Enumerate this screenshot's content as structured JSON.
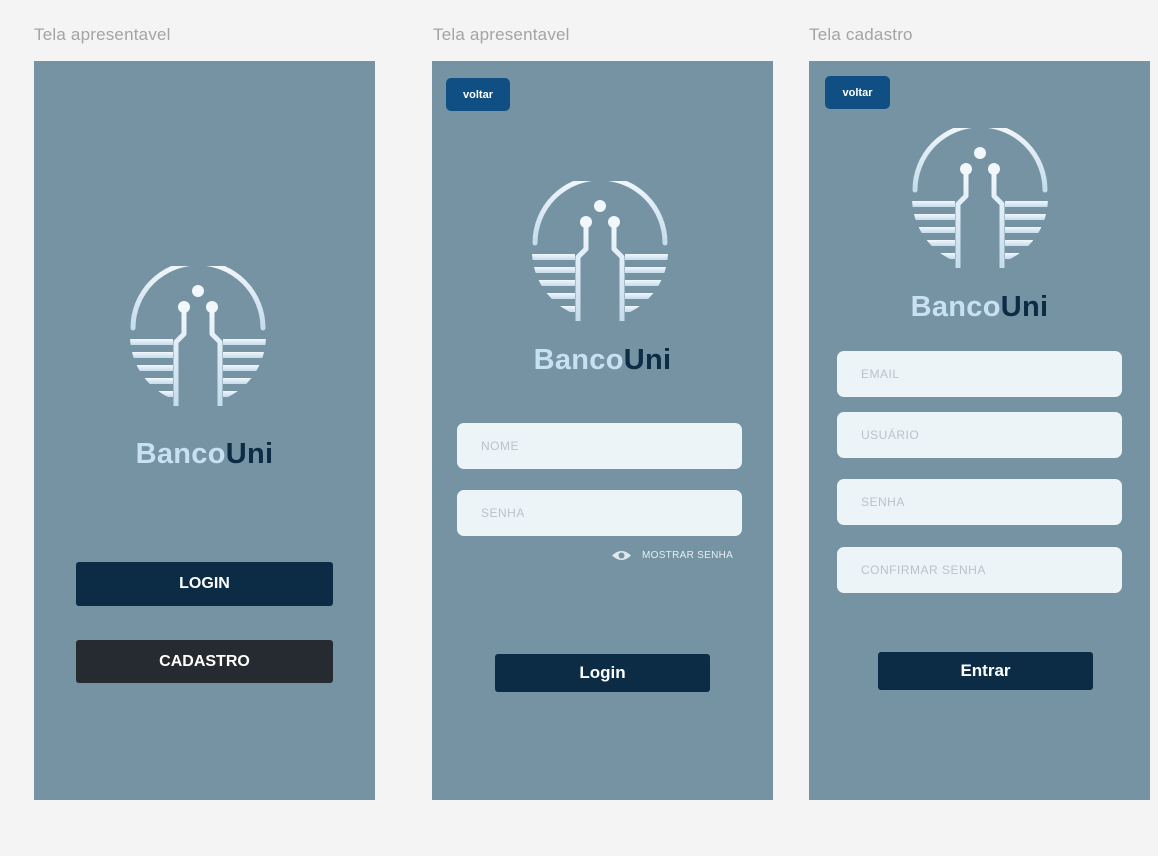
{
  "colors": {
    "canvas": "#f4f4f5",
    "screen": "#7593a3",
    "back_button": "#0f4f83",
    "login_button": "#0c2b45",
    "cadastro_button": "#262b31",
    "field": "#edf4f7",
    "logo": "#e8f1f8",
    "brand_light": "#c7e0f2",
    "brand_dark": "#0c2b45"
  },
  "brand": {
    "part1": "Banco",
    "part2": "Uni",
    "logo_icon": "circuit-globe-icon"
  },
  "screens": [
    {
      "title": "Tela apresentavel",
      "buttons": {
        "login_label": "LOGIN",
        "cadastro_label": "CADASTRO"
      }
    },
    {
      "title": "Tela apresentavel",
      "back_label": "voltar",
      "fields": {
        "nome_placeholder": "NOME",
        "senha_placeholder": "SENHA"
      },
      "show_password_label": "MOSTRAR SENHA",
      "show_password_icon": "eye-icon",
      "submit_label": "Login"
    },
    {
      "title": "Tela cadastro",
      "back_label": "voltar",
      "fields": {
        "email_placeholder": "EMAIL",
        "usuario_placeholder": "USUÁRIO",
        "senha_placeholder": "SENHA",
        "confirmar_placeholder": "CONFIRMAR SENHA"
      },
      "submit_label": "Entrar"
    }
  ]
}
